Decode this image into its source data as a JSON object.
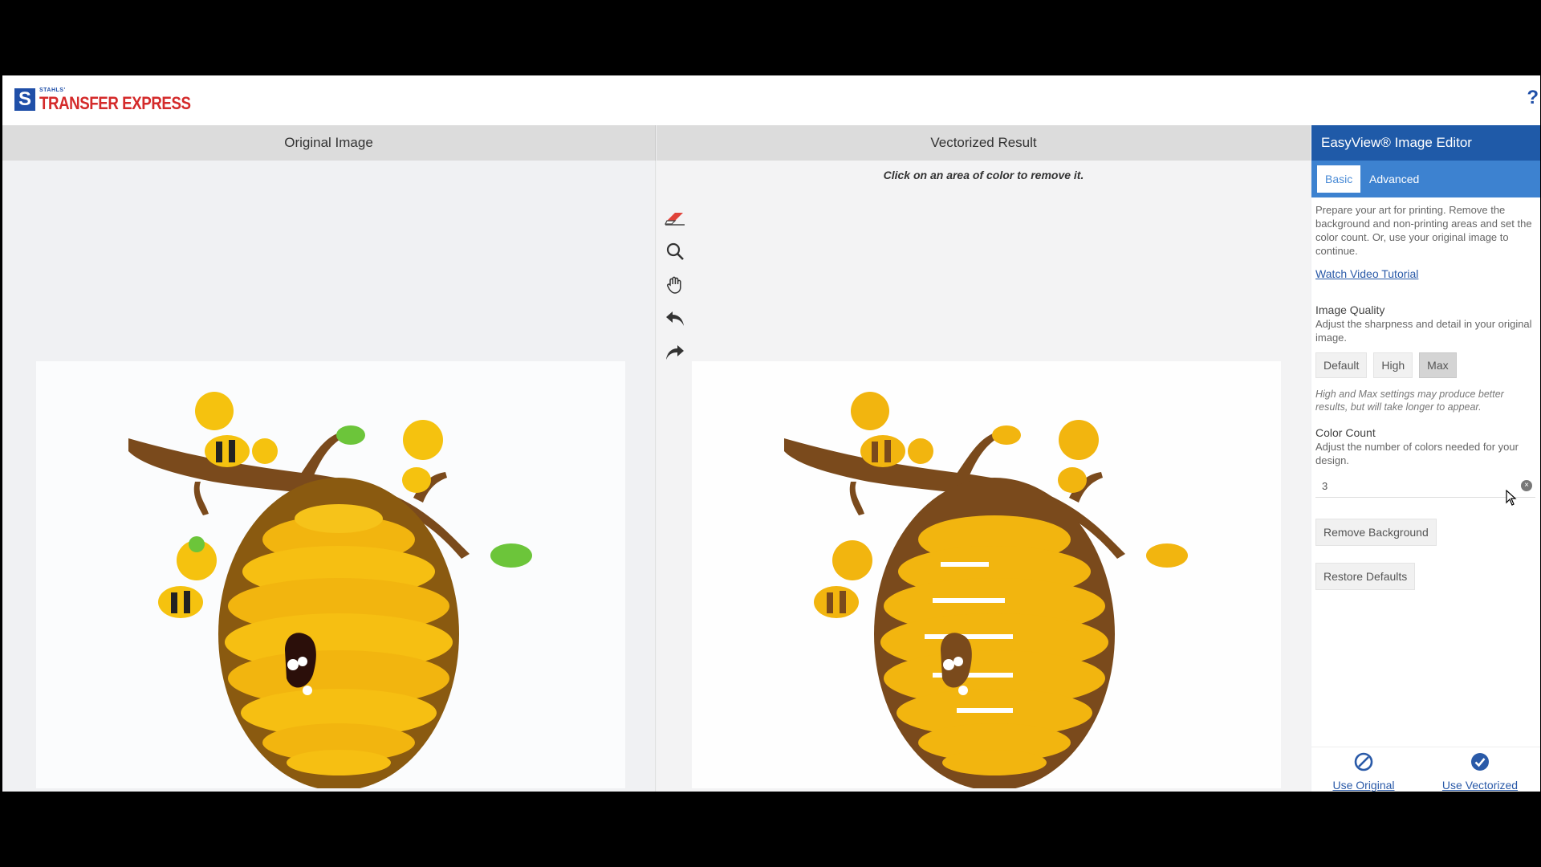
{
  "header": {
    "logo_small": "STAHLS'",
    "logo_main": "TRANSFER EXPRESS",
    "help": "?"
  },
  "panels": {
    "original_title": "Original Image",
    "vectorized_title": "Vectorized Result",
    "instruction": "Click on an area of color to remove it."
  },
  "toolbar": {
    "tools": [
      "eraser-icon",
      "search-icon",
      "hand-icon",
      "undo-icon",
      "redo-icon"
    ]
  },
  "editor": {
    "title": "EasyView® Image Editor",
    "tabs": {
      "basic": "Basic",
      "advanced": "Advanced",
      "active": "Basic"
    },
    "intro": "Prepare your art for printing. Remove the background and non-printing areas and set the color count. Or, use your original image to continue.",
    "video_link": "Watch Video Tutorial",
    "quality": {
      "title": "Image Quality",
      "desc": "Adjust the sharpness and detail in your original image.",
      "options": [
        "Default",
        "High",
        "Max"
      ],
      "selected": "Max",
      "note": "High and Max settings may produce better results, but will take longer to appear."
    },
    "color_count": {
      "title": "Color Count",
      "desc": "Adjust the number of colors needed for your design.",
      "value": "3"
    },
    "remove_background": "Remove Background",
    "restore_defaults": "Restore Defaults",
    "use_original": "Use Original",
    "use_vectorized": "Use Vectorized"
  },
  "colors": {
    "brand_blue": "#1f5aa8",
    "tab_blue": "#3d82d0",
    "logo_red": "#d42a2a",
    "honey": "#f2b50f",
    "branch": "#7a4a1c"
  }
}
